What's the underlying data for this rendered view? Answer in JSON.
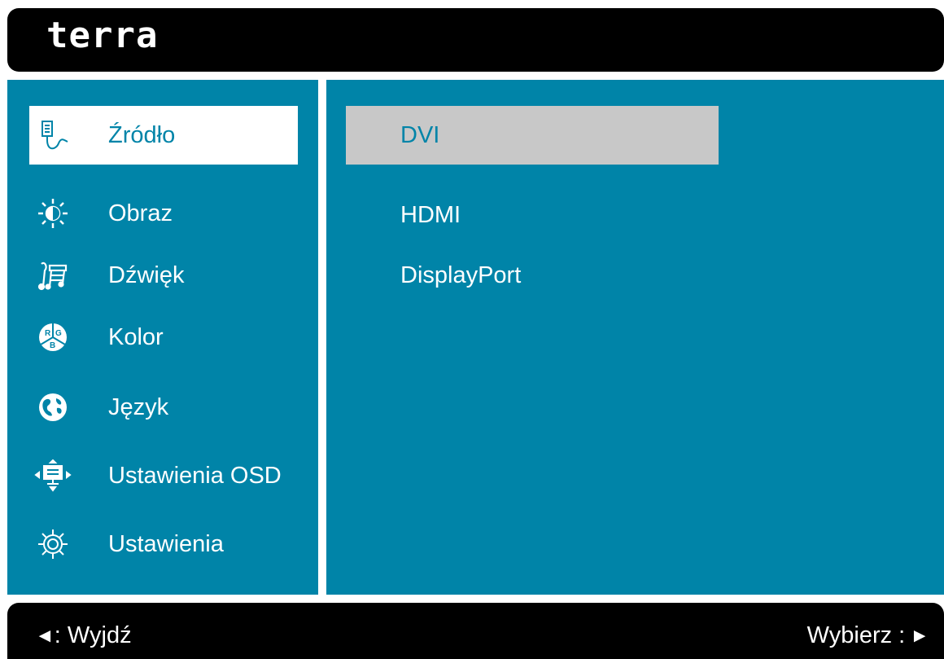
{
  "header": {
    "brand": "terra"
  },
  "sidebar": {
    "items": [
      {
        "label": "Źródło",
        "icon": "input-source-icon"
      },
      {
        "label": "Obraz",
        "icon": "brightness-icon"
      },
      {
        "label": "Dźwięk",
        "icon": "music-note-icon"
      },
      {
        "label": "Kolor",
        "icon": "rgb-color-icon"
      },
      {
        "label": "Język",
        "icon": "globe-icon"
      },
      {
        "label": "Ustawienia OSD",
        "icon": "osd-position-icon"
      },
      {
        "label": "Ustawienia",
        "icon": "gear-icon"
      }
    ],
    "selected_index": 0
  },
  "main": {
    "options": [
      {
        "label": "DVI"
      },
      {
        "label": "HDMI"
      },
      {
        "label": "DisplayPort"
      }
    ],
    "selected_index": 0
  },
  "footer": {
    "exit_arrow": "◄",
    "exit_label": ": Wyjdź",
    "select_label": "Wybierz :",
    "select_arrow": "►"
  },
  "colors": {
    "panel": "#0084a8",
    "selected_menu_bg": "#ffffff",
    "selected_option_bg": "#c8c8c8",
    "bar": "#000000"
  }
}
